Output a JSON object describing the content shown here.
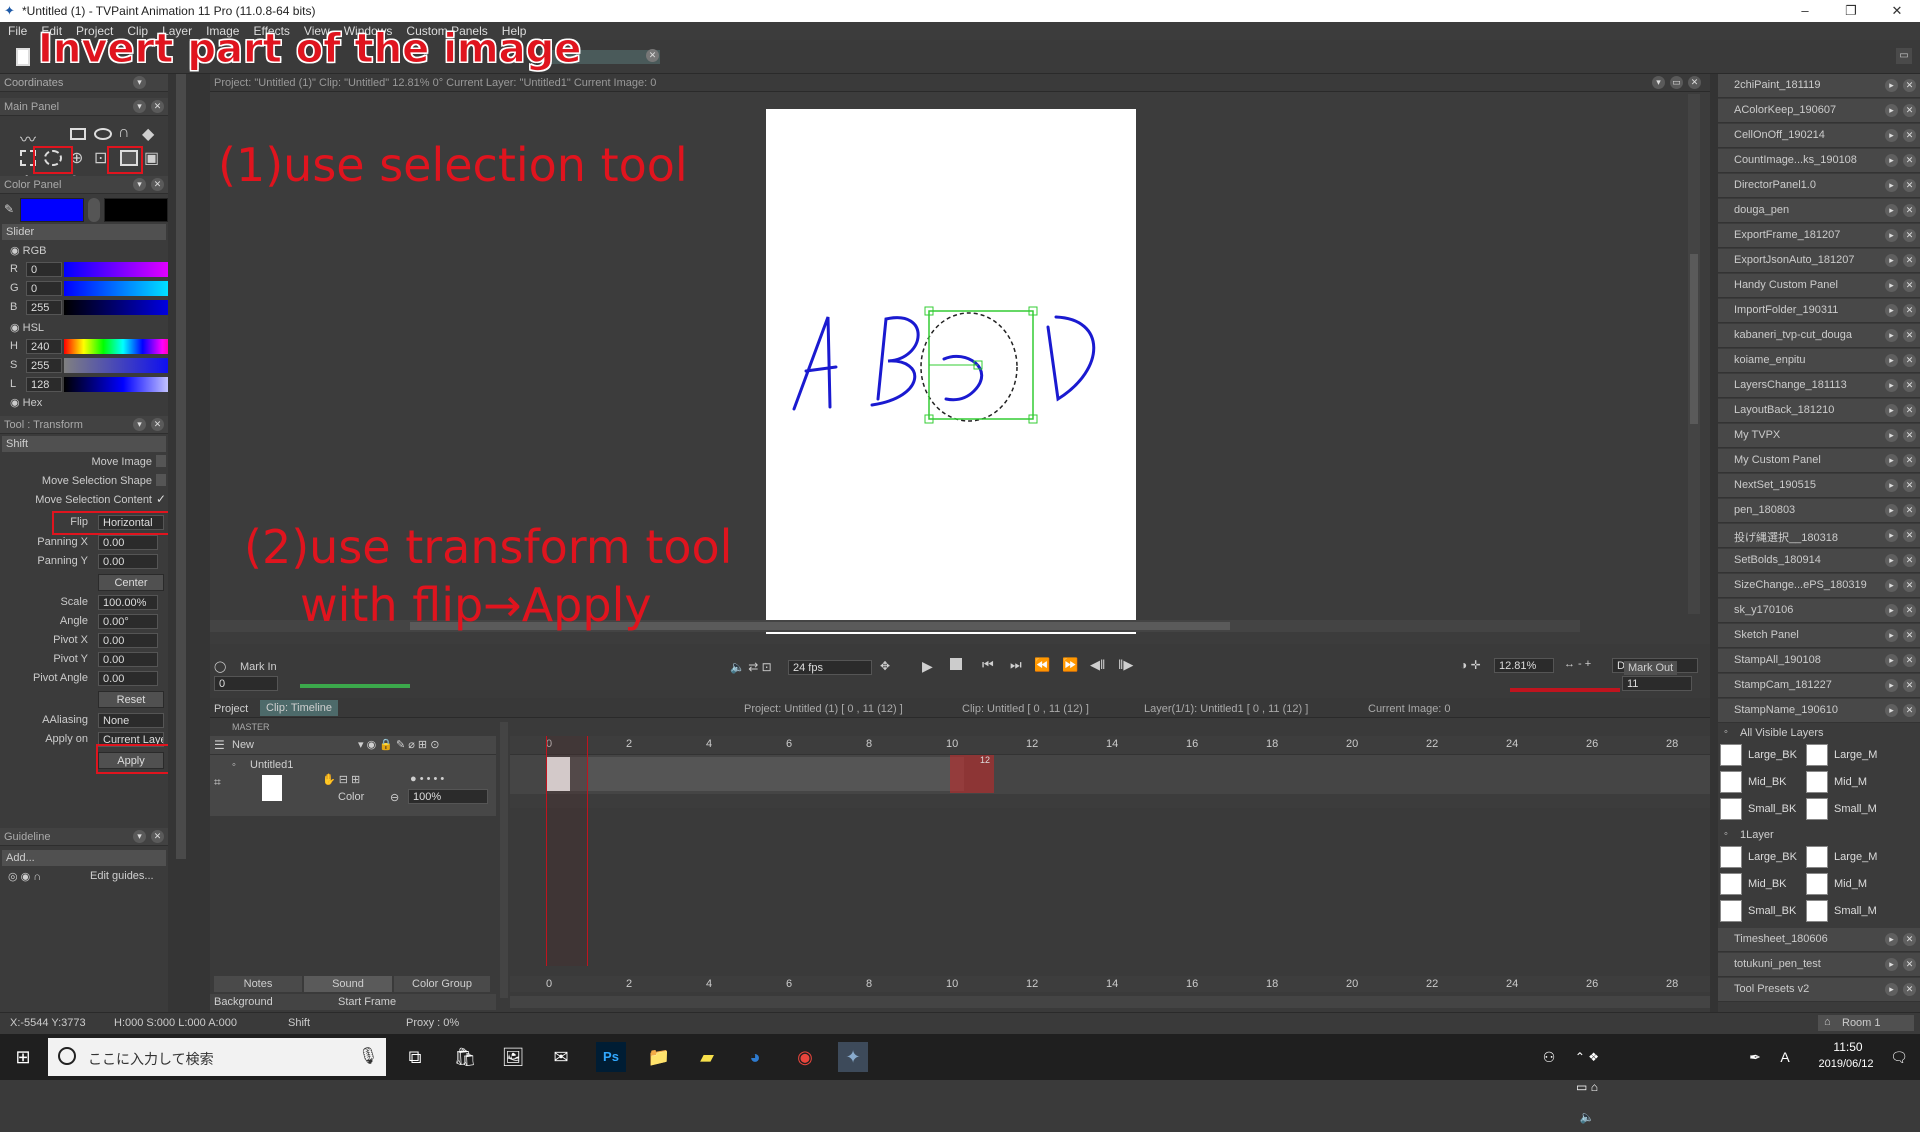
{
  "window": {
    "title": "*Untitled (1) - TVPaint Animation 11 Pro (11.0.8-64 bits)",
    "minimize": "–",
    "maximize": "❐",
    "close": "✕"
  },
  "menu": [
    "File",
    "Edit",
    "Project",
    "Clip",
    "Layer",
    "Image",
    "Effects",
    "View",
    "Windows",
    "Custom Panels",
    "Help"
  ],
  "annotations": {
    "title": "Invert part of the image",
    "step1": "(1)use selection tool",
    "step2_line1": "(2)use transform tool",
    "step2_line2": "with flip→Apply",
    "color": "#e0141e"
  },
  "panels": {
    "coordinates": "Coordinates",
    "main_panel": "Main Panel",
    "color_panel": "Color Panel",
    "slider": "Slider",
    "rgb": "RGB",
    "r_label": "R",
    "r_value": "0",
    "g_label": "G",
    "g_value": "0",
    "b_label": "B",
    "b_value": "255",
    "hsl": "HSL",
    "h_label": "H",
    "h_value": "240",
    "s_label": "S",
    "s_value": "255",
    "l_label": "L",
    "l_value": "128",
    "hex": "Hex",
    "primary_color": "#0000ff",
    "secondary_color": "#000000",
    "tool_transform": "Tool : Transform",
    "mode": "Shift",
    "move_image": "Move Image",
    "move_selection_shape": "Move Selection Shape",
    "move_selection_content": "Move Selection Content",
    "flip_label": "Flip",
    "flip_value": "Horizontal",
    "panning_x_label": "Panning X",
    "panning_x": "0.00",
    "panning_y_label": "Panning Y",
    "panning_y": "0.00",
    "center": "Center",
    "scale_label": "Scale",
    "scale": "100.00%",
    "angle_label": "Angle",
    "angle": "0.00°",
    "pivot_x_label": "Pivot X",
    "pivot_x": "0.00",
    "pivot_y_label": "Pivot Y",
    "pivot_y": "0.00",
    "pivot_angle_label": "Pivot Angle",
    "pivot_angle": "0.00",
    "reset": "Reset",
    "aaliasing_label": "AAliasing",
    "aaliasing": "None",
    "apply_on_label": "Apply on",
    "apply_on": "Current Layer",
    "apply": "Apply",
    "guideline": "Guideline",
    "add": "Add...",
    "edit_guides": "Edit guides..."
  },
  "canvas": {
    "info": "Project: \"Untitled (1)\"  Clip: \"Untitled\"  12.81%  0°  Current Layer: \"Untitled1\"  Current Image: 0",
    "drawing_letters": [
      "A",
      "B",
      "D"
    ]
  },
  "transport": {
    "mark_in": "Mark In",
    "mark_out": "Mark Out",
    "fps": "24 fps",
    "in_value": "0",
    "out_value": "11",
    "zoom": "12.81%",
    "display": "Display"
  },
  "timeline": {
    "project_tab": "Project",
    "clip_tab": "Clip: Timeline",
    "project_info": "Project: Untitled (1) [ 0 , 11  (12) ]",
    "clip_info": "Clip: Untitled [ 0 , 11  (12) ]",
    "layer_info": "Layer(1/1): Untitled1 [ 0 , 11  (12) ]",
    "current_image": "Current Image: 0",
    "master": "MASTER",
    "new_label": "New",
    "layer_name": "Untitled1",
    "color_label": "Color",
    "opacity": "100%",
    "frame_numbers": [
      "0",
      "2",
      "4",
      "6",
      "8",
      "10",
      "12",
      "14",
      "16",
      "18",
      "20",
      "22",
      "24",
      "26",
      "28"
    ],
    "end_marker": "12",
    "frame_one": "1",
    "notes": "Notes",
    "sound": "Sound",
    "color_group": "Color Group",
    "background": "Background",
    "start_frame": "Start Frame"
  },
  "right_panel": {
    "items": [
      "2chiPaint_181119",
      "AColorKeep_190607",
      "CellOnOff_190214",
      "CountImage...ks_190108",
      "DirectorPanel1.0",
      "douga_pen",
      "ExportFrame_181207",
      "ExportJsonAuto_181207",
      "Handy Custom Panel",
      "ImportFolder_190311",
      "kabaneri_tvp-cut_douga",
      "koiame_enpitu",
      "LayersChange_181113",
      "LayoutBack_181210",
      "My TVPX",
      "My Custom Panel",
      "NextSet_190515",
      "pen_180803",
      "投げ縄選択__180318",
      "SetBolds_180914",
      "SizeChange...ePS_180319",
      "sk_y170106",
      "Sketch Panel",
      "StampAll_190108",
      "StampCam_181227",
      "StampName_190610"
    ],
    "all_visible_layers": "All Visible Layers",
    "one_layer": "1Layer",
    "stamps_a": [
      "Large_BK",
      "Large_M",
      "Mid_BK",
      "Mid_M",
      "Small_BK",
      "Small_M"
    ],
    "stamps_b": [
      "Large_BK",
      "Large_M",
      "Mid_BK",
      "Mid_M",
      "Small_BK",
      "Small_M"
    ],
    "bottom_items": [
      "Timesheet_180606",
      "totukuni_pen_test",
      "Tool Presets v2"
    ],
    "room": "Room 1"
  },
  "status": {
    "coords": "X:-5544  Y:3773",
    "hsl": "H:000 S:000 L:000 A:000",
    "mode": "Shift",
    "proxy": "Proxy : 0%"
  },
  "taskbar": {
    "search_placeholder": "ここに入力して検索",
    "time": "11:50",
    "date": "2019/06/12",
    "ime": "A"
  }
}
